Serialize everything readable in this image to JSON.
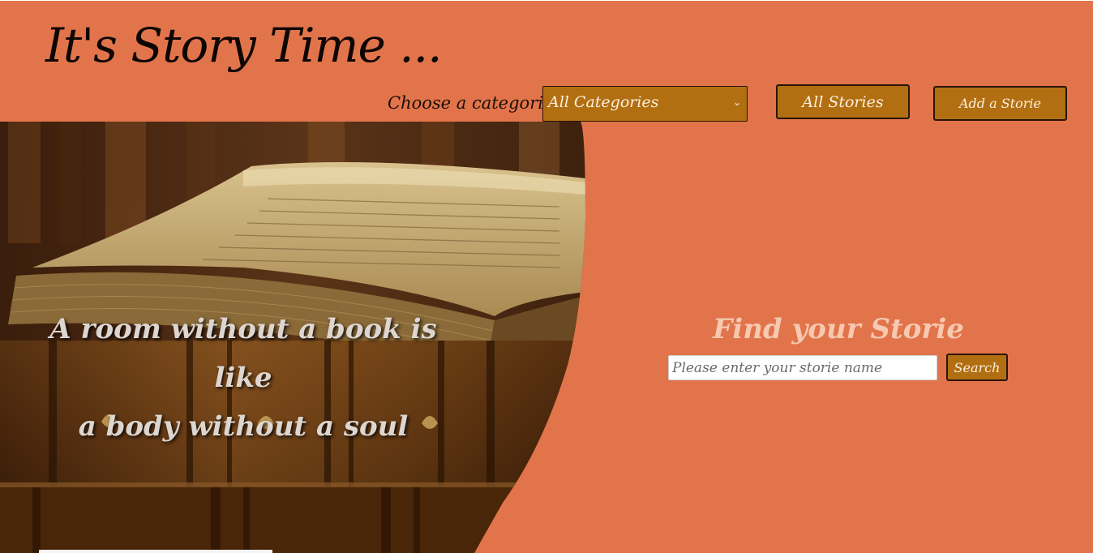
{
  "header": {
    "title": "It's Story Time ..."
  },
  "nav": {
    "category_label": "Choose a categorie",
    "category_selected": "All Categories",
    "all_stories_label": "All Stories",
    "add_story_label": "Add a Storie"
  },
  "hero": {
    "quote_line1": "A room without a book is like",
    "quote_line2": "a body without a soul"
  },
  "find": {
    "title": "Find your Storie",
    "search_placeholder": "Please enter your storie name",
    "search_button": "Search"
  },
  "colors": {
    "background": "#e2744b",
    "button": "#b26f12",
    "button_border": "#2a1404",
    "find_title": "#f6c9b0"
  }
}
